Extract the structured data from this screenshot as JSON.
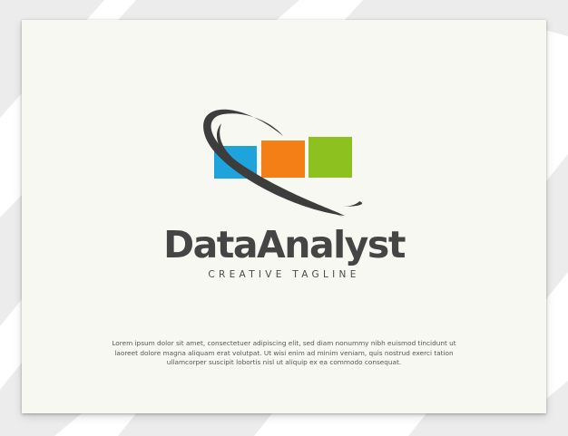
{
  "brand": {
    "name": "DataAnalyst",
    "tagline": "CREATIVE TAGLINE"
  },
  "body_text": "Lorem ipsum dolor sit amet, consectetuer adipiscing elit, sed diam nonummy nibh euismod tincidunt ut laoreet dolore magna aliquam erat volutpat. Ut wisi enim ad minim veniam, quis nostrud exerci tation ullamcorper suscipit lobortis nisl ut aliquip ex ea commodo consequat.",
  "logo": {
    "icon": "bar-chart-with-orbit-swoosh",
    "colors": {
      "bar_blue": "#1fa3dc",
      "bar_orange": "#f57f17",
      "bar_green": "#8cc11f",
      "swoosh": "#3d3d3d",
      "text": "#454545"
    }
  },
  "colors": {
    "card_background": "#f8f8f3",
    "page_background": "#ffffff",
    "stripe": "#e9e9e9"
  }
}
